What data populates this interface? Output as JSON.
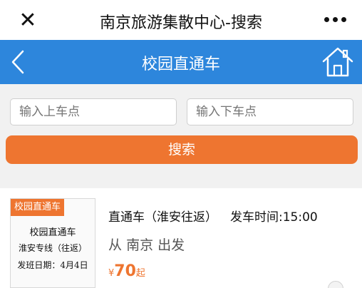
{
  "wechat_bar": {
    "title": "南京旅游集散中心-搜索",
    "close_icon": "close-icon",
    "more_icon": "more-icon"
  },
  "nav": {
    "title": "校园直通车",
    "back_icon": "chevron-left-icon",
    "home_icon": "home-icon",
    "color": "#2d86dc"
  },
  "search": {
    "start_placeholder": "输入上车点",
    "end_placeholder": "输入下车点",
    "button_label": "搜索",
    "button_color": "#ee7530"
  },
  "results": [
    {
      "thumb_tag": "校园直通车",
      "thumb_lines": [
        "校园直通车",
        "淮安专线（往返）",
        "发班日期：4月4日"
      ],
      "route_name": "直通车（淮安往返）",
      "departure_label": "发车时间:",
      "departure_time": "15:00",
      "origin_prefix": "从",
      "origin_city": "南京",
      "origin_suffix": "出发",
      "price_currency": "¥",
      "price_value": "70",
      "price_suffix": "起"
    }
  ]
}
